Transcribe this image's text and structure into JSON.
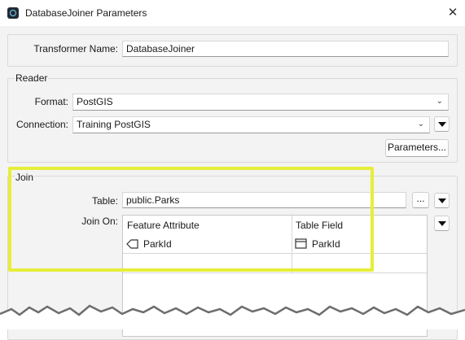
{
  "window": {
    "title": "DatabaseJoiner Parameters",
    "close_glyph": "✕"
  },
  "transformer": {
    "label": "Transformer Name:",
    "value": "DatabaseJoiner"
  },
  "reader": {
    "group_title": "Reader",
    "format_label": "Format:",
    "format_value": "PostGIS",
    "connection_label": "Connection:",
    "connection_value": "Training PostGIS",
    "parameters_button": "Parameters..."
  },
  "join": {
    "group_title": "Join",
    "table_label": "Table:",
    "table_value": "public.Parks",
    "browse_button": "...",
    "join_on_label": "Join On:",
    "columns": [
      "Feature Attribute",
      "Table Field"
    ],
    "rows": [
      {
        "feature_attribute": "ParkId",
        "table_field": "ParkId"
      }
    ]
  },
  "colors": {
    "highlight": "#e6ee3a"
  }
}
